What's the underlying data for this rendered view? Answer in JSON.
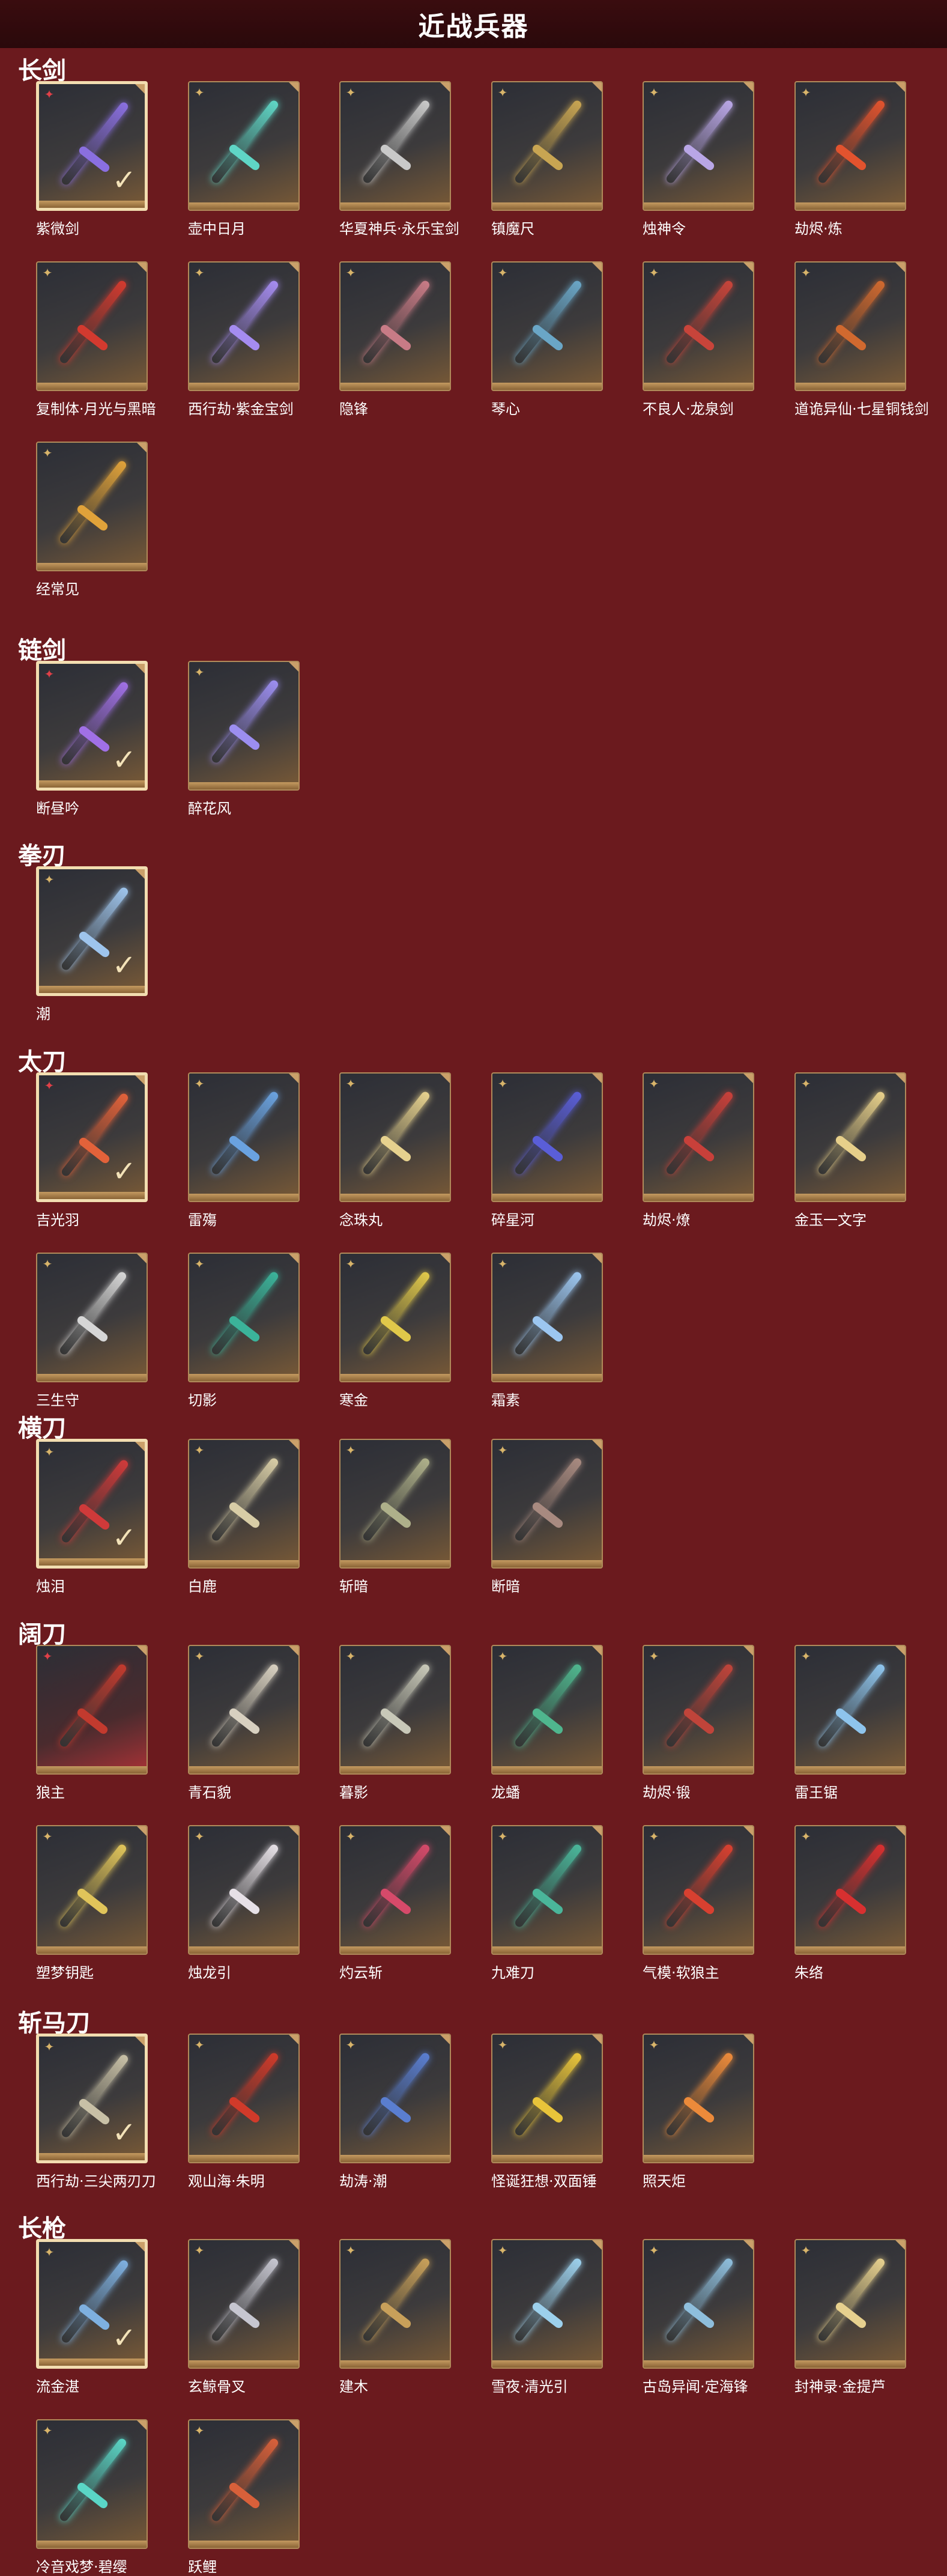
{
  "header": {
    "title": "近战兵器"
  },
  "sections": [
    {
      "title": "长剑",
      "items": [
        {
          "label": "紫微剑",
          "rarity": "red",
          "selected": true,
          "color": "#8a6fe0"
        },
        {
          "label": "壶中日月",
          "rarity": "gold",
          "selected": false,
          "color": "#5fd6c6"
        },
        {
          "label": "华夏神兵·永乐宝剑",
          "rarity": "gold",
          "selected": false,
          "color": "#c9c9c9"
        },
        {
          "label": "镇魔尺",
          "rarity": "gold",
          "selected": false,
          "color": "#c8a552"
        },
        {
          "label": "烛神令",
          "rarity": "gold",
          "selected": false,
          "color": "#b9a6e6"
        },
        {
          "label": "劫烬·炼",
          "rarity": "gold",
          "selected": false,
          "color": "#e2532e"
        },
        {
          "label": "复制体·月光与黑暗",
          "rarity": "gold",
          "selected": false,
          "color": "#d23a2f"
        },
        {
          "label": "西行劫·紫金宝剑",
          "rarity": "gold",
          "selected": false,
          "color": "#a58cf0"
        },
        {
          "label": "隐锋",
          "rarity": "gold",
          "selected": false,
          "color": "#c87b86"
        },
        {
          "label": "琴心",
          "rarity": "gold",
          "selected": false,
          "color": "#6aa6c6"
        },
        {
          "label": "不良人·龙泉剑",
          "rarity": "gold",
          "selected": false,
          "color": "#c8443a"
        },
        {
          "label": "道诡异仙·七星铜钱剑",
          "rarity": "gold",
          "selected": false,
          "color": "#d0692f"
        },
        {
          "label": "经常见",
          "rarity": "gold",
          "selected": false,
          "color": "#e0a23a"
        }
      ]
    },
    {
      "title": "链剑",
      "items": [
        {
          "label": "断昼吟",
          "rarity": "red",
          "selected": true,
          "color": "#a070e6"
        },
        {
          "label": "醉花风",
          "rarity": "gold",
          "selected": false,
          "color": "#9c8ef0"
        }
      ]
    },
    {
      "title": "拳刃",
      "items": [
        {
          "label": "潮",
          "rarity": "gold",
          "selected": true,
          "color": "#9ec4ec"
        }
      ]
    },
    {
      "title": "太刀",
      "items": [
        {
          "label": "吉光羽",
          "rarity": "red",
          "selected": true,
          "color": "#e2623a"
        },
        {
          "label": "雷殤",
          "rarity": "gold",
          "selected": false,
          "color": "#6aa2e0"
        },
        {
          "label": "念珠丸",
          "rarity": "gold",
          "selected": false,
          "color": "#e6d18e"
        },
        {
          "label": "碎星河",
          "rarity": "gold",
          "selected": false,
          "color": "#5a5ed8"
        },
        {
          "label": "劫烬·燎",
          "rarity": "gold",
          "selected": false,
          "color": "#c8403a"
        },
        {
          "label": "金玉一文字",
          "rarity": "gold",
          "selected": false,
          "color": "#e6cf8a"
        },
        {
          "label": "三生守",
          "rarity": "gold",
          "selected": false,
          "color": "#d6d6d6"
        },
        {
          "label": "切影",
          "rarity": "gold",
          "selected": false,
          "color": "#3bb39a"
        },
        {
          "label": "寒金",
          "rarity": "gold",
          "selected": false,
          "color": "#e0c84a"
        },
        {
          "label": "霜素",
          "rarity": "gold",
          "selected": false,
          "color": "#9cc6f0"
        }
      ]
    },
    {
      "title": "横刀",
      "items": [
        {
          "label": "烛泪",
          "rarity": "gold",
          "selected": true,
          "color": "#cf3a3a"
        },
        {
          "label": "白鹿",
          "rarity": "gold",
          "selected": false,
          "color": "#d8cda6"
        },
        {
          "label": "斩暗",
          "rarity": "gold",
          "selected": false,
          "color": "#aeb08a"
        },
        {
          "label": "断暗",
          "rarity": "gold",
          "selected": false,
          "color": "#a88a80"
        }
      ]
    },
    {
      "title": "阔刀",
      "items": [
        {
          "label": "狼主",
          "rarity": "red",
          "selected": false,
          "color": "#c23a2e",
          "red": true
        },
        {
          "label": "青石貌",
          "rarity": "gold",
          "selected": false,
          "color": "#d8d0c0"
        },
        {
          "label": "暮影",
          "rarity": "gold",
          "selected": false,
          "color": "#c8c8b8"
        },
        {
          "label": "龙蟠",
          "rarity": "gold",
          "selected": false,
          "color": "#4fb68e"
        },
        {
          "label": "劫烬·锻",
          "rarity": "gold",
          "selected": false,
          "color": "#c0443a"
        },
        {
          "label": "雷王锯",
          "rarity": "gold",
          "selected": false,
          "color": "#8ec4ec"
        },
        {
          "label": "塑梦钥匙",
          "rarity": "gold",
          "selected": false,
          "color": "#e0c45a"
        },
        {
          "label": "烛龙引",
          "rarity": "gold",
          "selected": false,
          "color": "#e6e0e6"
        },
        {
          "label": "灼云斩",
          "rarity": "gold",
          "selected": false,
          "color": "#d64a6a"
        },
        {
          "label": "九难刀",
          "rarity": "gold",
          "selected": false,
          "color": "#4ab69a"
        },
        {
          "label": "气模·软狼主",
          "rarity": "gold",
          "selected": false,
          "color": "#d84030"
        },
        {
          "label": "朱络",
          "rarity": "gold",
          "selected": false,
          "color": "#d83030"
        }
      ]
    },
    {
      "title": "斩马刀",
      "items": [
        {
          "label": "西行劫·三尖两刃刀",
          "rarity": "gold",
          "selected": true,
          "color": "#c8c0a6"
        },
        {
          "label": "观山海·朱明",
          "rarity": "gold",
          "selected": false,
          "color": "#d03a2a"
        },
        {
          "label": "劫涛·潮",
          "rarity": "gold",
          "selected": false,
          "color": "#5a7ed0"
        },
        {
          "label": "怪诞狂想·双面锤",
          "rarity": "gold",
          "selected": false,
          "color": "#e8c43a"
        },
        {
          "label": "照天炬",
          "rarity": "gold",
          "selected": false,
          "color": "#ec8a3a"
        }
      ]
    },
    {
      "title": "长枪",
      "items": [
        {
          "label": "流金湛",
          "rarity": "gold",
          "selected": true,
          "color": "#7eb0e0"
        },
        {
          "label": "玄鲸骨叉",
          "rarity": "gold",
          "selected": false,
          "color": "#c6c6d0"
        },
        {
          "label": "建木",
          "rarity": "gold",
          "selected": false,
          "color": "#c8a05a"
        },
        {
          "label": "雪夜·清光引",
          "rarity": "gold",
          "selected": false,
          "color": "#9cd0ec"
        },
        {
          "label": "古岛异闻·定海锋",
          "rarity": "gold",
          "selected": false,
          "color": "#8ebedc"
        },
        {
          "label": "封神录·金提芦",
          "rarity": "gold",
          "selected": false,
          "color": "#e6d08e"
        },
        {
          "label": "冷音戏梦·碧缨",
          "rarity": "gold",
          "selected": false,
          "color": "#5ad6c6"
        },
        {
          "label": "跃鲤",
          "rarity": "gold",
          "selected": false,
          "color": "#d8603a"
        }
      ]
    }
  ],
  "icons": {
    "rarity_gold": "gold-sparkle-icon",
    "rarity_red": "red-sparkle-icon",
    "selected": "check-icon"
  },
  "colors": {
    "background": "#6b1a1e",
    "header": "#2a090b",
    "tile_border": "#b08a5a",
    "selected_border": "#f2ddb0"
  }
}
